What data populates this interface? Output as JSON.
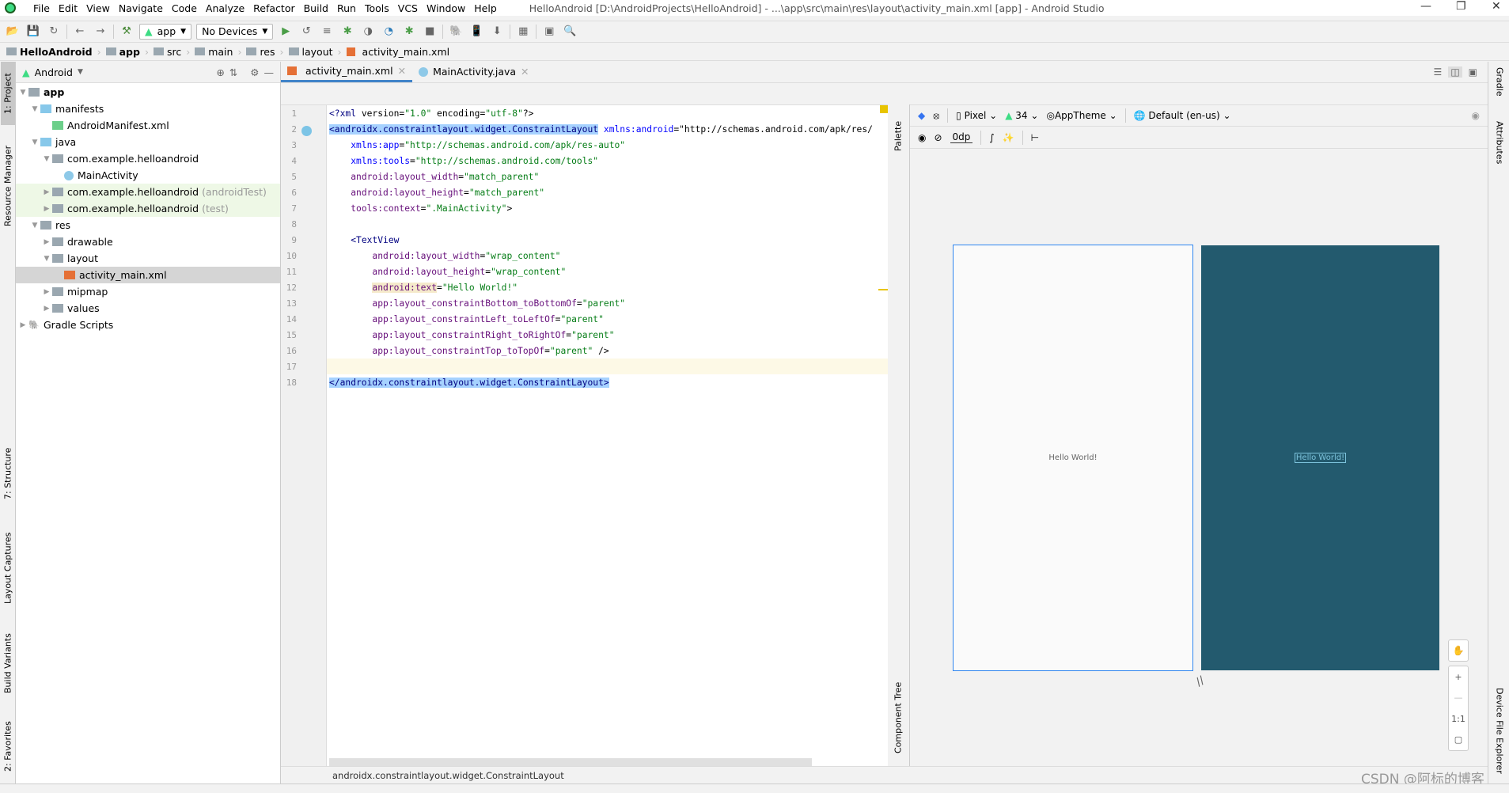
{
  "window": {
    "title": "HelloAndroid [D:\\AndroidProjects\\HelloAndroid] - ...\\app\\src\\main\\res\\layout\\activity_main.xml [app] - Android Studio"
  },
  "menu": [
    "File",
    "Edit",
    "View",
    "Navigate",
    "Code",
    "Analyze",
    "Refactor",
    "Build",
    "Run",
    "Tools",
    "VCS",
    "Window",
    "Help"
  ],
  "toolbar": {
    "run_config": "app",
    "device": "No Devices"
  },
  "breadcrumb": [
    "HelloAndroid",
    "app",
    "src",
    "main",
    "res",
    "layout",
    "activity_main.xml"
  ],
  "left_strip": {
    "project": "1: Project",
    "resource_manager": "Resource Manager",
    "structure": "7: Structure",
    "layout_captures": "Layout Captures",
    "build_variants": "Build Variants",
    "favorites": "2: Favorites"
  },
  "project": {
    "view": "Android",
    "tree": [
      {
        "label": "app",
        "depth": 0,
        "expand": "open",
        "bold": true
      },
      {
        "label": "manifests",
        "depth": 1,
        "expand": "open"
      },
      {
        "label": "AndroidManifest.xml",
        "depth": 2,
        "expand": "none"
      },
      {
        "label": "java",
        "depth": 1,
        "expand": "open"
      },
      {
        "label": "com.example.helloandroid",
        "depth": 2,
        "expand": "open"
      },
      {
        "label": "MainActivity",
        "depth": 3,
        "expand": "none"
      },
      {
        "label": "com.example.helloandroid",
        "suffix": "(androidTest)",
        "depth": 2,
        "expand": "closed",
        "tint": true
      },
      {
        "label": "com.example.helloandroid",
        "suffix": "(test)",
        "depth": 2,
        "expand": "closed",
        "tint": true
      },
      {
        "label": "res",
        "depth": 1,
        "expand": "open"
      },
      {
        "label": "drawable",
        "depth": 2,
        "expand": "closed"
      },
      {
        "label": "layout",
        "depth": 2,
        "expand": "open"
      },
      {
        "label": "activity_main.xml",
        "depth": 3,
        "expand": "none",
        "selected": true
      },
      {
        "label": "mipmap",
        "depth": 2,
        "expand": "closed"
      },
      {
        "label": "values",
        "depth": 2,
        "expand": "closed"
      },
      {
        "label": "Gradle Scripts",
        "depth": 0,
        "expand": "closed"
      }
    ]
  },
  "tabs": [
    {
      "label": "activity_main.xml",
      "active": true
    },
    {
      "label": "MainActivity.java",
      "active": false
    }
  ],
  "code": [
    "<?xml version=\"1.0\" encoding=\"utf-8\"?>",
    "<androidx.constraintlayout.widget.ConstraintLayout xmlns:android=\"http://schemas.android.com/apk/res/",
    "    xmlns:app=\"http://schemas.android.com/apk/res-auto\"",
    "    xmlns:tools=\"http://schemas.android.com/tools\"",
    "    android:layout_width=\"match_parent\"",
    "    android:layout_height=\"match_parent\"",
    "    tools:context=\".MainActivity\">",
    "",
    "    <TextView",
    "        android:layout_width=\"wrap_content\"",
    "        android:layout_height=\"wrap_content\"",
    "        android:text=\"Hello World!\"",
    "        app:layout_constraintBottom_toBottomOf=\"parent\"",
    "        app:layout_constraintLeft_toLeftOf=\"parent\"",
    "        app:layout_constraintRight_toRightOf=\"parent\"",
    "        app:layout_constraintTop_toTopOf=\"parent\" />",
    "",
    "</androidx.constraintlayout.widget.ConstraintLayout>"
  ],
  "design": {
    "palette": "Palette",
    "component_tree": "Component Tree",
    "attributes": "Attributes",
    "device": "Pixel",
    "api": "34",
    "theme": "AppTheme",
    "locale": "Default (en-us)",
    "margin": "0dp",
    "preview_text": "Hello World!",
    "blueprint_text": "Hello World!",
    "zoom_reset": "1:1",
    "blueprint_color": "#235a6e",
    "device_file_explorer": "Device File Explorer",
    "gradle": "Gradle"
  },
  "status": {
    "path": "androidx.constraintlayout.widget.ConstraintLayout"
  },
  "watermark": "CSDN @阿标的博客"
}
